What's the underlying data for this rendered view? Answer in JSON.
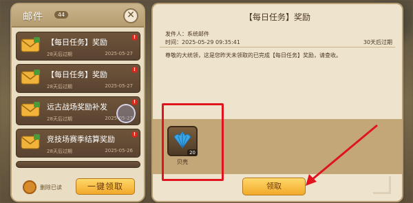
{
  "mailbox": {
    "title": "邮件",
    "count": "44",
    "close_symbol": "✕",
    "items": [
      {
        "subject": "【每日任务】奖励",
        "expire": "28天后过期",
        "date": "2025-05-27",
        "alert": "!"
      },
      {
        "subject": "【每日任务】奖励",
        "expire": "28天后过期",
        "date": "2025-05-27",
        "alert": "!"
      },
      {
        "subject": "远古战场奖励补发",
        "expire": "28天后过期",
        "date": "2025-05-27",
        "alert": "!"
      },
      {
        "subject": "竞技场赛季结算奖励",
        "expire": "28天后过期",
        "date": "2025-05-26",
        "alert": "!"
      }
    ],
    "footer": {
      "delete_read": "删除已读",
      "claim_all": "一键领取"
    }
  },
  "detail": {
    "title": "【每日任务】奖励",
    "sender": "发件人：系统邮件",
    "sent_time": "时间：2025-05-29 09:35:41",
    "expire_note": "30天后过期",
    "body": "尊敬的大统领，这是您昨天未领取的已完成【每日任务】奖励，请查收。",
    "attachments": [
      {
        "name": "贝壳",
        "quantity": "20",
        "icon": "shell-icon"
      }
    ],
    "claim_label": "领取"
  },
  "colors": {
    "highlight": "#e0141d",
    "button_gold": "#f2a92a",
    "panel_bg": "#eee3cc",
    "item_bg": "#594331"
  }
}
